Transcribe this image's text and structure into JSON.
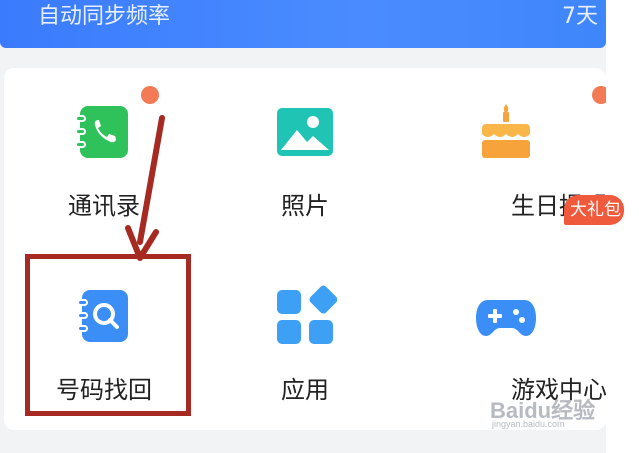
{
  "header": {
    "label": "自动同步频率",
    "value": "7天"
  },
  "grid": {
    "items": [
      {
        "label": "通讯录",
        "icon": "contacts-icon",
        "color": "#2fc25b",
        "badge_dot": true
      },
      {
        "label": "照片",
        "icon": "photo-icon",
        "color": "#20c4b4",
        "badge_dot": false
      },
      {
        "label": "生日提醒",
        "icon": "birthday-cake-icon",
        "color": "#f7a33b",
        "badge_dot": true
      },
      {
        "label": "号码找回",
        "icon": "number-recovery-icon",
        "color": "#3a8ef6",
        "badge_dot": false
      },
      {
        "label": "应用",
        "icon": "apps-icon",
        "color": "#3da0f5",
        "badge_dot": false
      },
      {
        "label": "游戏中心",
        "icon": "gamepad-icon",
        "color": "#3a8ef6",
        "badge_dot": false,
        "badge_text": "大礼包"
      }
    ]
  },
  "annotation": {
    "color": "#a62a22"
  },
  "watermark": {
    "line1": "Baidu经验",
    "line2": "jingyan.baidu.com"
  }
}
